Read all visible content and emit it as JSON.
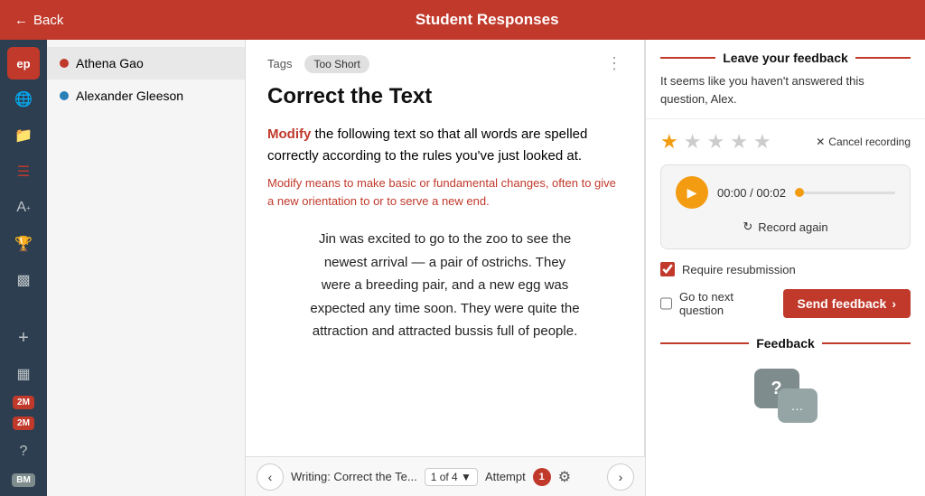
{
  "header": {
    "back_label": "Back",
    "title": "Student Responses"
  },
  "students": [
    {
      "id": "athena",
      "name": "Athena Gao",
      "dot_color": "#c0392b",
      "active": true
    },
    {
      "id": "alexander",
      "name": "Alexander Gleeson",
      "dot_color": "#2980b9",
      "active": false
    }
  ],
  "question": {
    "tags_label": "Tags",
    "tag": "Too Short",
    "title": "Correct the Text",
    "instruction_pre": "the following text so that all words are spelled correctly according to the rules you've just looked at.",
    "highlight": "Modify",
    "definition": "Modify means to make basic or fundamental changes, often to give a new orientation to or to serve a new end.",
    "passage": "Jin was excited to go to the zoo to see the newest arrival — a pair of ostrichs. They were a breeding pair, and a new egg was expected any time soon. They were quite the attraction and attracted bussis full of people."
  },
  "bottom_nav": {
    "nav_text": "Writing: Correct the Te...",
    "page_info": "1 of 4",
    "attempt_label": "Attempt",
    "attempt_num": "1"
  },
  "feedback_panel": {
    "section_title": "Leave your feedback",
    "unanswered_text": "It seems like you haven't answered this question, Alex.",
    "stars": [
      true,
      false,
      false,
      false,
      false
    ],
    "cancel_recording_label": "Cancel recording",
    "time_current": "00:00",
    "time_total": "00:02",
    "record_again_label": "Record again",
    "require_resubmission_label": "Require resubmission",
    "require_resubmission_checked": true,
    "go_next_label": "Go to next question",
    "go_next_checked": false,
    "send_feedback_label": "Send feedback",
    "feedback_section_title": "Feedback"
  }
}
